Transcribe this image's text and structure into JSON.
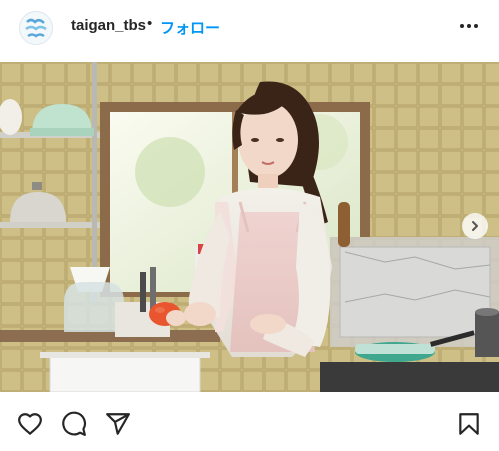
{
  "post": {
    "username": "taigan_tbs",
    "separator": "•",
    "follow_label": "フォロー"
  },
  "icons": {
    "more": "more-horizontal-icon",
    "next": "chevron-right-icon",
    "like": "heart-icon",
    "comment": "comment-icon",
    "share": "send-icon",
    "save": "bookmark-icon"
  },
  "colors": {
    "accent": "#0095f6",
    "text": "#262626"
  }
}
